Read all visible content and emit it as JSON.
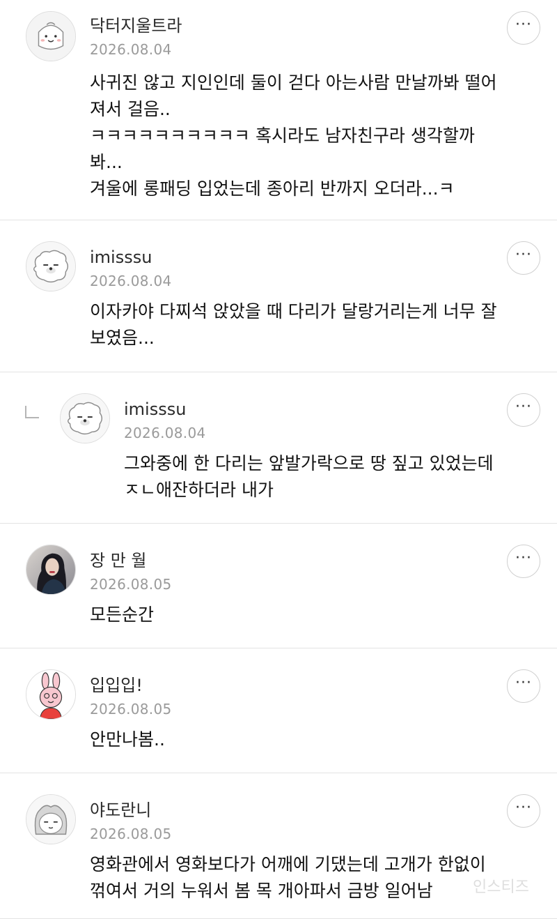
{
  "comments": [
    {
      "username": "닥터지울트라",
      "date": "2026.08.04",
      "avatar": "smiling-character-avatar",
      "lines": [
        "사귀진 않고 지인인데 둘이 걷다 아는사람 만날까봐 떨어",
        "져서 걸음..",
        "ㅋㅋㅋㅋㅋㅋㅋㅋㅋㅋ 혹시라도 남자친구라 생각할까",
        "봐...",
        "겨울에 롱패딩 입었는데 종아리 반까지 오더라...ㅋ"
      ]
    },
    {
      "username": "imisssu",
      "date": "2026.08.04",
      "avatar": "fluffy-dog-avatar",
      "lines": [
        "이자카야 다찌석 앉았을 때 다리가 달랑거리는게 너무 잘",
        "보였음..."
      ]
    },
    {
      "username": "imisssu",
      "date": "2026.08.04",
      "avatar": "fluffy-dog-avatar",
      "is_reply": true,
      "lines": [
        "그와중에 한 다리는 앞발가락으로 땅 짚고 있었는데",
        "ㅈㄴ애잔하더라 내가"
      ]
    },
    {
      "username": "장 만 월",
      "date": "2026.08.05",
      "avatar": "portrait-photo-avatar",
      "lines": [
        "모든순간"
      ]
    },
    {
      "username": "입입입!",
      "date": "2026.08.05",
      "avatar": "pink-rabbit-avatar",
      "lines": [
        "안만나봄.."
      ]
    },
    {
      "username": "야도란니",
      "date": "2026.08.05",
      "avatar": "sleepy-character-avatar",
      "lines": [
        "영화관에서 영화보다가 어깨에 기댔는데 고개가 한없이",
        "꺾여서 거의 누워서 봄 목 개아파서 금방 일어남"
      ]
    }
  ],
  "more_label": "···",
  "watermark": "인스티즈",
  "colors": {
    "divider": "#e3e3e3",
    "date": "#9a9a9a",
    "text": "#111111"
  }
}
